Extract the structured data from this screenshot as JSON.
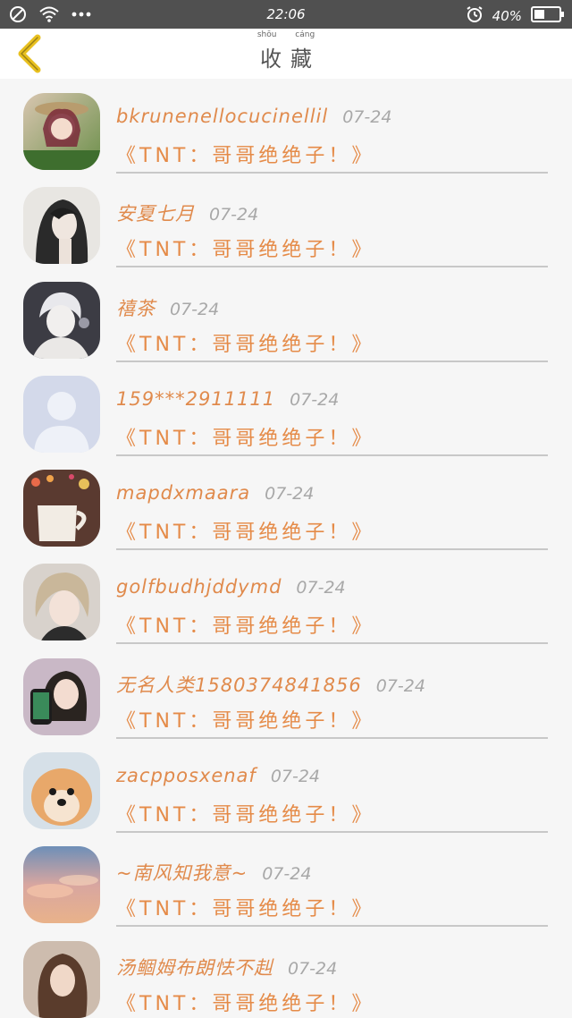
{
  "status_bar": {
    "time": "22:06",
    "battery": "40%"
  },
  "header": {
    "title": "收藏",
    "title_pinyin": "shōu cáng"
  },
  "colors": {
    "accent": "#e58b48",
    "status_bar": "#505050",
    "background": "#f6f6f6",
    "back_arrow": "#e8c020"
  },
  "favorites": [
    {
      "username": "bkrunenellocucinellil",
      "date": "07-24",
      "message": "《TNT：哥哥绝绝子！》"
    },
    {
      "username": "安夏七月",
      "date": "07-24",
      "message": "《TNT：哥哥绝绝子！》"
    },
    {
      "username": "禧茶",
      "date": "07-24",
      "message": "《TNT：哥哥绝绝子！》"
    },
    {
      "username": "159***2911111",
      "date": "07-24",
      "message": "《TNT：哥哥绝绝子！》"
    },
    {
      "username": "mapdxmaara",
      "date": "07-24",
      "message": "《TNT：哥哥绝绝子！》"
    },
    {
      "username": "golfbudhjddymd",
      "date": "07-24",
      "message": "《TNT：哥哥绝绝子！》"
    },
    {
      "username": "无名人类15803748418​56",
      "date": "07-24",
      "message": "《TNT：哥哥绝绝子！》"
    },
    {
      "username": "zacpposxenaf",
      "date": "07-24",
      "message": "《TNT：哥哥绝绝子！》"
    },
    {
      "username": "~南风知我意~",
      "date": "07-24",
      "message": "《TNT：哥哥绝绝子！》"
    },
    {
      "username": "汤鲴姆布朗怯不赳",
      "date": "07-24",
      "message": "《TNT：哥哥绝绝子！》"
    }
  ],
  "icons": {
    "back": "chevron-left-icon",
    "wifi": "wifi-icon",
    "more": "more-dots-icon",
    "block": "no-sim-icon",
    "alarm": "alarm-icon",
    "battery": "battery-icon"
  }
}
